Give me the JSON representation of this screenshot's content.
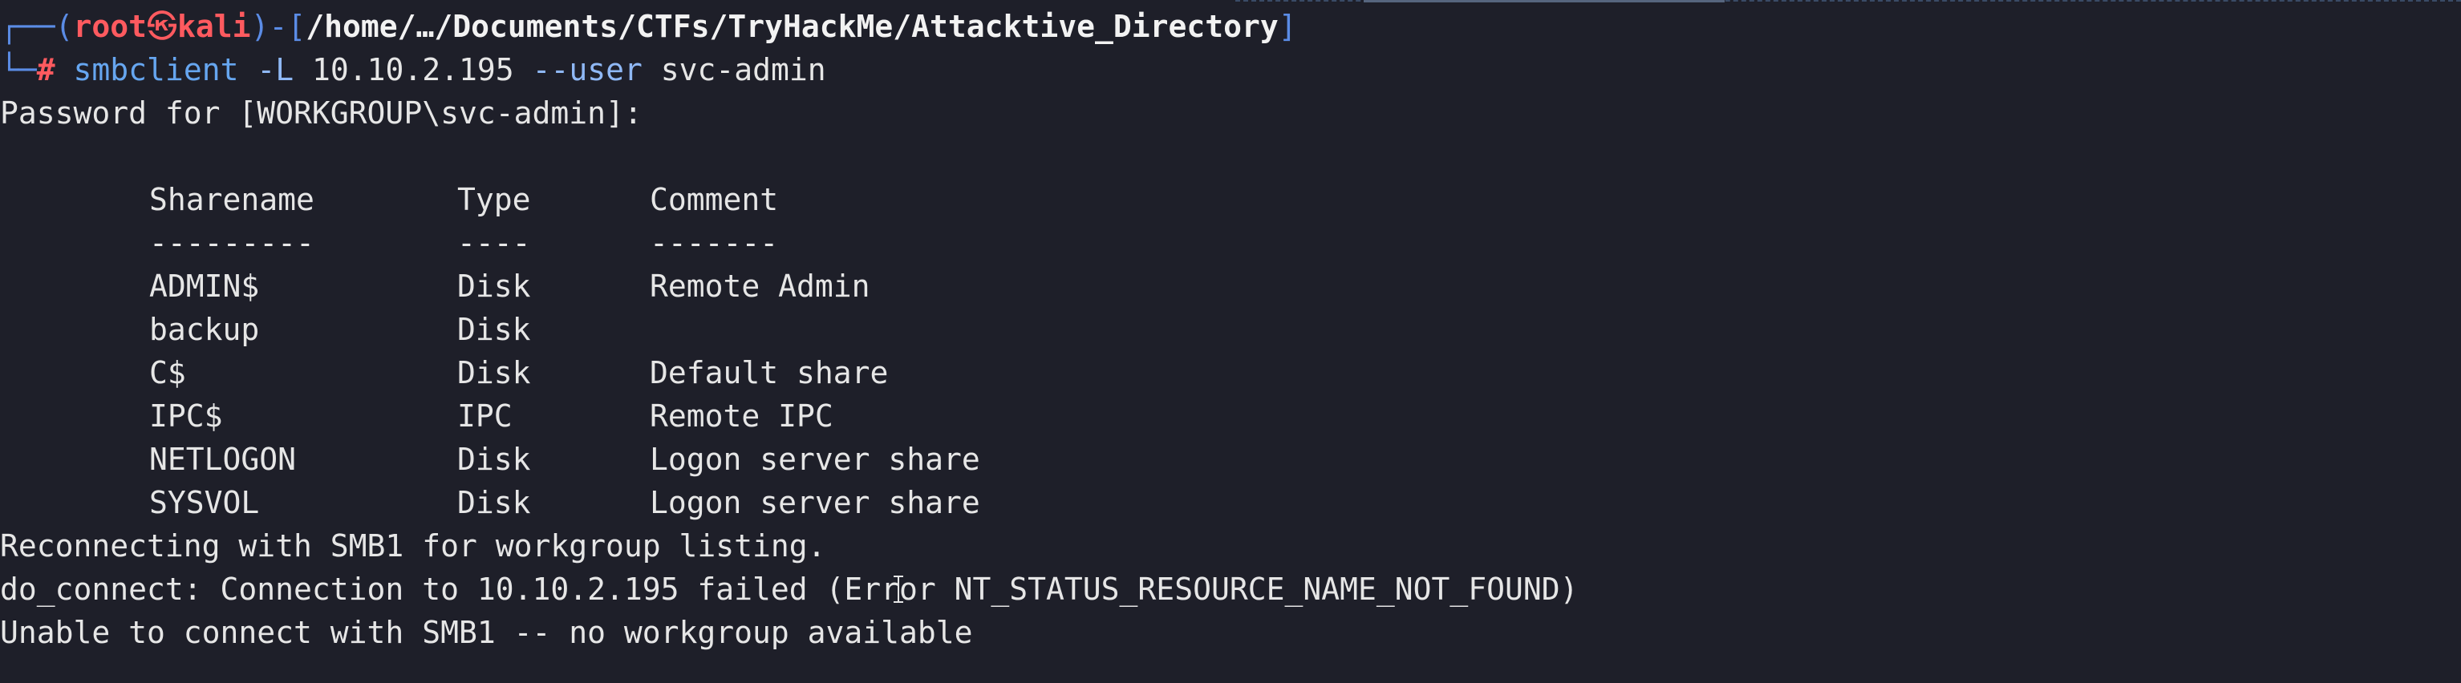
{
  "prompt": {
    "frame_top": "┌──(",
    "user": "root",
    "at_symbol": "㉿",
    "host": "kali",
    "mid": ")-[",
    "path": "/home/…/Documents/CTFs/TryHackMe/Attacktive_Directory",
    "close": "]",
    "frame_bottom": "└─",
    "hash": "#"
  },
  "command": {
    "program": "smbclient",
    "flag_L": "-L",
    "ip": "10.10.2.195",
    "flag_user": "--user",
    "user_value": "svc-admin"
  },
  "output": {
    "password_prompt": "Password for [WORKGROUP\\svc-admin]:",
    "table": {
      "headers": [
        "Sharename",
        "Type",
        "Comment"
      ],
      "separators": [
        "---------",
        "----",
        "-------"
      ],
      "rows": [
        [
          "ADMIN$",
          "Disk",
          "Remote Admin"
        ],
        [
          "backup",
          "Disk",
          ""
        ],
        [
          "C$",
          "Disk",
          "Default share"
        ],
        [
          "IPC$",
          "IPC",
          "Remote IPC"
        ],
        [
          "NETLOGON",
          "Disk",
          "Logon server share"
        ],
        [
          "SYSVOL",
          "Disk",
          "Logon server share"
        ]
      ]
    },
    "reconnect": "Reconnecting with SMB1 for workgroup listing.",
    "do_connect": "do_connect: Connection to 10.10.2.195 failed (Error NT_STATUS_RESOURCE_NAME_NOT_FOUND)",
    "unable": "Unable to connect with SMB1 -- no workgroup available"
  },
  "colors": {
    "background": "#1e1f29",
    "prompt_frame": "#5b8ce6",
    "prompt_user": "#ff5a5f",
    "text": "#e6e6e6"
  },
  "icons": {
    "mouse_cursor": "text-ibeam-cursor-icon"
  }
}
